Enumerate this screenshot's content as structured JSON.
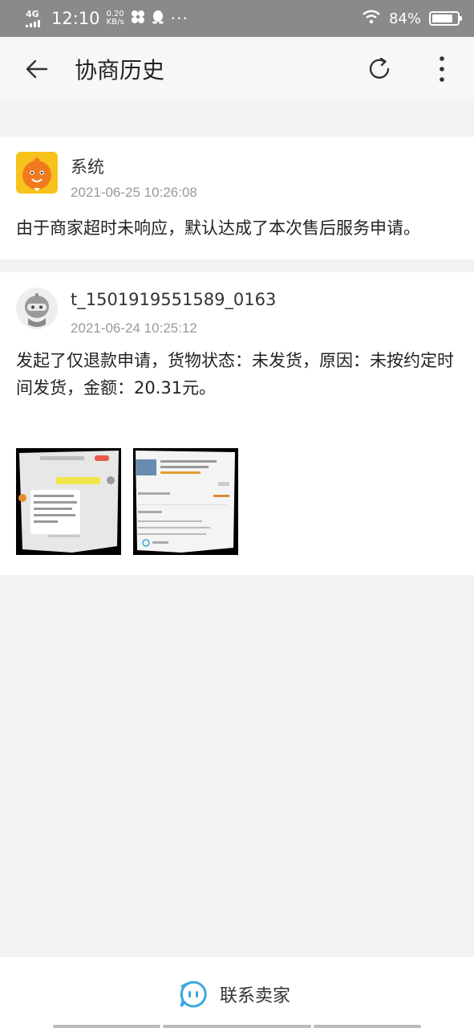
{
  "status_bar": {
    "network": "4G",
    "time": "12:10",
    "speed_value": "0.20",
    "speed_unit": "KB/s",
    "battery": "84%",
    "icons": [
      "signal-icon",
      "pinwheel-icon",
      "qq-penguin-icon",
      "more-dots-icon",
      "wifi-icon",
      "battery-icon"
    ]
  },
  "header": {
    "title": "协商历史",
    "icons": [
      "back-arrow-icon",
      "refresh-icon",
      "more-vertical-icon"
    ]
  },
  "records": [
    {
      "name": "系统",
      "time": "2021-06-25 10:26:08",
      "message": "由于商家超时未响应，默认达成了本次售后服务申请。",
      "avatar": "system-mascot-avatar"
    },
    {
      "name": "t_1501919551589_0163",
      "time": "2021-06-24 10:25:12",
      "message": "发起了仅退款申请，货物状态：未发货，原因：未按约定时间发货，金额：20.31元。",
      "avatar": "user-robot-avatar",
      "attachments": [
        "chat-screenshot-thumbnail",
        "order-screenshot-thumbnail"
      ]
    }
  ],
  "footer": {
    "contact_label": "联系卖家",
    "icon": "chat-bubble-icon"
  },
  "colors": {
    "status_bar": "#8a8a8a",
    "background": "#f2f2f2",
    "accent": "#3aa7e0",
    "mascot": "#f07a1e"
  }
}
